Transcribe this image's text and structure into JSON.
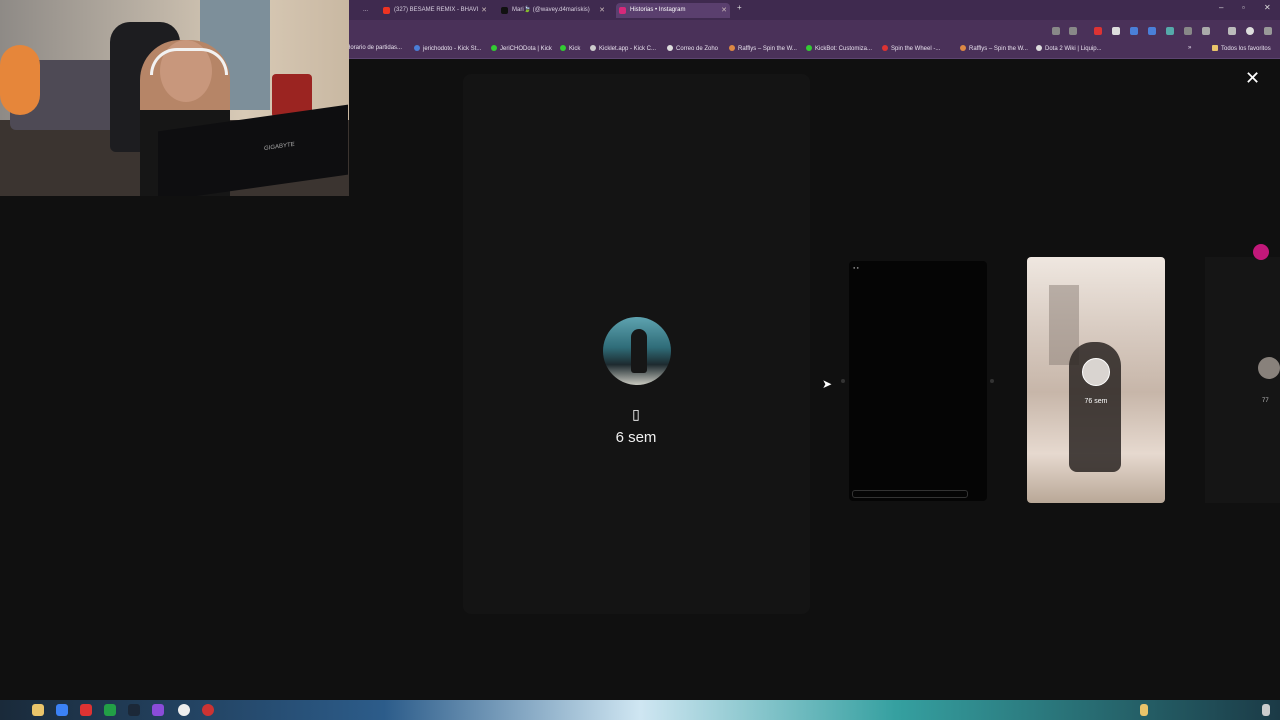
{
  "browser": {
    "tabs": [
      {
        "label": "...",
        "active": false
      },
      {
        "label": "(327) BESAME REMIX - BHAVI",
        "active": false
      },
      {
        "label": "Mari🍃 (@wavey.d4mariskis)",
        "active": false
      },
      {
        "label": "Historias • Instagram",
        "active": true
      }
    ],
    "new_tab": "+",
    "window_controls": {
      "minimize": "–",
      "maximize": "▫",
      "close": "✕"
    },
    "bookmarks": [
      "Horario de partidas...",
      "jerichodoto - Kick St...",
      "JeriCHODota | Kick",
      "Kick",
      "Kicklet.app - Kick C...",
      "Correo de Zoho",
      "Rafflys – Spin the W...",
      "KickBot: Customiza...",
      "Spin the Wheel -...",
      "Rafflys – Spin the W...",
      "Dota 2 Wiki | Liquip...",
      "»",
      "Todos los favoritos"
    ]
  },
  "stories": {
    "current": {
      "glyph": "▯",
      "time": "6 sem"
    },
    "next": {
      "time": "76 sem"
    },
    "edge_time": "77"
  },
  "close_label": "✕",
  "webcam": {
    "monitor_brand": "GIGABYTE"
  },
  "colors": {
    "tab_bar": "#3f2a4f",
    "toolbar": "#4a3159",
    "background": "#101010",
    "extension_accent": "#c2187a"
  }
}
